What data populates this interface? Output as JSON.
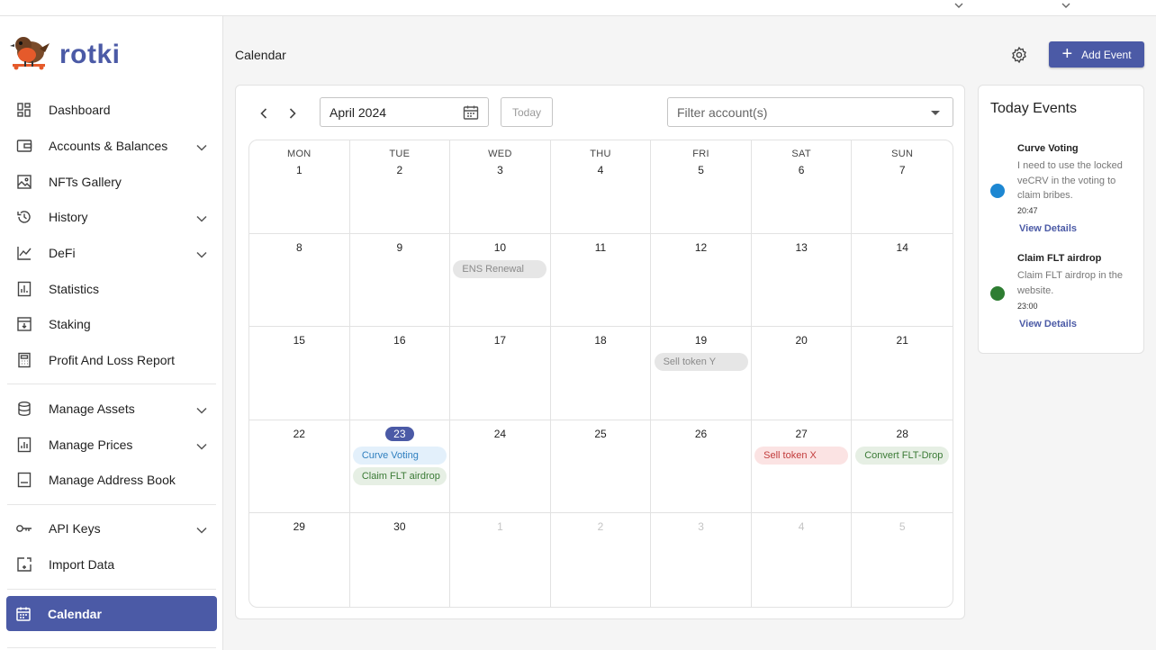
{
  "app": {
    "name": "rotki"
  },
  "page": {
    "title": "Calendar"
  },
  "sidebar": {
    "items": [
      {
        "label": "Dashboard",
        "icon": "dashboard-icon",
        "chevron": false
      },
      {
        "label": "Accounts & Balances",
        "icon": "wallet-icon",
        "chevron": true
      },
      {
        "label": "NFTs Gallery",
        "icon": "image-icon",
        "chevron": false
      },
      {
        "label": "History",
        "icon": "history-icon",
        "chevron": true
      },
      {
        "label": "DeFi",
        "icon": "line-chart-icon",
        "chevron": true
      },
      {
        "label": "Statistics",
        "icon": "bar-chart-icon",
        "chevron": false
      },
      {
        "label": "Staking",
        "icon": "staking-icon",
        "chevron": false
      },
      {
        "label": "Profit And Loss Report",
        "icon": "calculator-icon",
        "chevron": false
      },
      {
        "label": "Manage Assets",
        "icon": "database-icon",
        "chevron": true
      },
      {
        "label": "Manage Prices",
        "icon": "price-chart-icon",
        "chevron": true
      },
      {
        "label": "Manage Address Book",
        "icon": "address-book-icon",
        "chevron": false
      },
      {
        "label": "API Keys",
        "icon": "key-icon",
        "chevron": true
      },
      {
        "label": "Import Data",
        "icon": "import-icon",
        "chevron": false
      },
      {
        "label": "Calendar",
        "icon": "calendar-icon",
        "chevron": false,
        "active": true
      }
    ]
  },
  "header": {
    "add_event_label": "Add Event"
  },
  "calendar": {
    "month_value": "April 2024",
    "today_label": "Today",
    "filter_placeholder": "Filter account(s)",
    "weekdays": [
      "MON",
      "TUE",
      "WED",
      "THU",
      "FRI",
      "SAT",
      "SUN"
    ],
    "days": [
      {
        "n": "1"
      },
      {
        "n": "2"
      },
      {
        "n": "3"
      },
      {
        "n": "4"
      },
      {
        "n": "5"
      },
      {
        "n": "6"
      },
      {
        "n": "7"
      },
      {
        "n": "8"
      },
      {
        "n": "9"
      },
      {
        "n": "10",
        "events": [
          {
            "label": "ENS Renewal",
            "bg": "#e6e6e6",
            "fg": "#8a8a8a"
          }
        ]
      },
      {
        "n": "11"
      },
      {
        "n": "12"
      },
      {
        "n": "13"
      },
      {
        "n": "14"
      },
      {
        "n": "15"
      },
      {
        "n": "16"
      },
      {
        "n": "17"
      },
      {
        "n": "18"
      },
      {
        "n": "19",
        "events": [
          {
            "label": "Sell token Y",
            "bg": "#e6e6e6",
            "fg": "#8a8a8a"
          }
        ]
      },
      {
        "n": "20"
      },
      {
        "n": "21"
      },
      {
        "n": "22"
      },
      {
        "n": "23",
        "today": true,
        "events": [
          {
            "label": "Curve Voting",
            "bg": "#e3f0fb",
            "fg": "#2f7fbf"
          },
          {
            "label": "Claim FLT airdrop",
            "bg": "#e6efe4",
            "fg": "#3a7a35"
          }
        ]
      },
      {
        "n": "24"
      },
      {
        "n": "25"
      },
      {
        "n": "26"
      },
      {
        "n": "27",
        "events": [
          {
            "label": "Sell token X",
            "bg": "#fbe3e3",
            "fg": "#c23b3b"
          }
        ]
      },
      {
        "n": "28",
        "events": [
          {
            "label": "Convert FLT-Drop",
            "bg": "#e6efe4",
            "fg": "#3a7a35"
          }
        ]
      },
      {
        "n": "29"
      },
      {
        "n": "30"
      },
      {
        "n": "1",
        "other": true
      },
      {
        "n": "2",
        "other": true
      },
      {
        "n": "3",
        "other": true
      },
      {
        "n": "4",
        "other": true
      },
      {
        "n": "5",
        "other": true
      }
    ]
  },
  "today_events": {
    "title": "Today Events",
    "items": [
      {
        "title": "Curve Voting",
        "description": "I need to use the locked veCRV in the voting to claim bribes.",
        "time": "20:47",
        "link": "View Details",
        "color": "#1d87d2"
      },
      {
        "title": "Claim FLT airdrop",
        "description": "Claim FLT airdrop in the website.",
        "time": "23:00",
        "link": "View Details",
        "color": "#2e7d32"
      }
    ]
  },
  "colors": {
    "accent": "#4b5aa6"
  }
}
